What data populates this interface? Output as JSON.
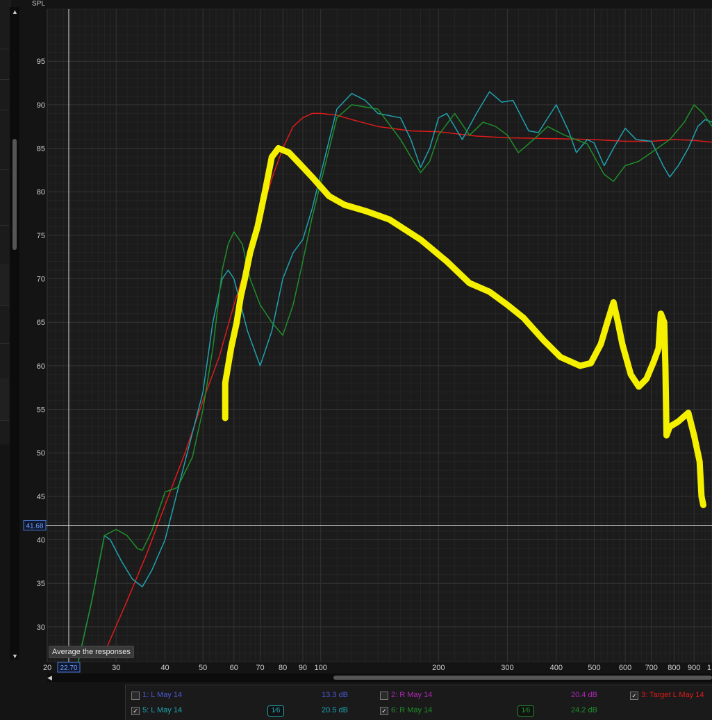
{
  "chart_data": {
    "type": "line",
    "ylabel": "SPL",
    "x_scale": "log",
    "xlim": [
      20,
      1000
    ],
    "ylim": [
      26,
      101
    ],
    "grid": true,
    "y_ticks": [
      30,
      35,
      40,
      45,
      50,
      55,
      60,
      65,
      70,
      75,
      80,
      85,
      90,
      95
    ],
    "x_ticks": [
      {
        "v": 20,
        "label": "20"
      },
      {
        "v": 30,
        "label": "30"
      },
      {
        "v": 40,
        "label": "40"
      },
      {
        "v": 50,
        "label": "50"
      },
      {
        "v": 60,
        "label": "60"
      },
      {
        "v": 70,
        "label": "70"
      },
      {
        "v": 80,
        "label": "80"
      },
      {
        "v": 90,
        "label": "90"
      },
      {
        "v": 100,
        "label": "100"
      },
      {
        "v": 200,
        "label": "200"
      },
      {
        "v": 300,
        "label": "300"
      },
      {
        "v": 400,
        "label": "400"
      },
      {
        "v": 500,
        "label": "500"
      },
      {
        "v": 600,
        "label": "600"
      },
      {
        "v": 700,
        "label": "700"
      },
      {
        "v": 800,
        "label": "800"
      },
      {
        "v": 900,
        "label": "900"
      },
      {
        "v": 1000,
        "label": "1"
      }
    ],
    "cursor": {
      "x": 22.7,
      "y": 41.68,
      "x_label": "22.70",
      "y_label": "41.68"
    },
    "series": [
      {
        "name": "3: Target L May 14",
        "color": "#e01b1b",
        "points": [
          [
            28,
            27
          ],
          [
            32,
            33
          ],
          [
            36,
            38.5
          ],
          [
            40,
            44
          ],
          [
            45,
            50
          ],
          [
            50,
            56
          ],
          [
            55,
            61
          ],
          [
            60,
            67
          ],
          [
            65,
            72
          ],
          [
            70,
            77
          ],
          [
            75,
            81.5
          ],
          [
            80,
            85
          ],
          [
            85,
            87.5
          ],
          [
            90,
            88.5
          ],
          [
            95,
            89
          ],
          [
            100,
            89
          ],
          [
            110,
            88.8
          ],
          [
            120,
            88.3
          ],
          [
            140,
            87.5
          ],
          [
            170,
            87
          ],
          [
            200,
            86.9
          ],
          [
            250,
            86.4
          ],
          [
            300,
            86.2
          ],
          [
            400,
            86.1
          ],
          [
            500,
            86
          ],
          [
            600,
            85.8
          ],
          [
            700,
            85.8
          ],
          [
            800,
            86
          ],
          [
            900,
            85.9
          ],
          [
            1000,
            85.7
          ]
        ]
      },
      {
        "name": "5: L May 14",
        "color": "#1fa3b0",
        "points": [
          [
            24,
            26
          ],
          [
            26,
            33
          ],
          [
            28,
            40.5
          ],
          [
            29,
            40
          ],
          [
            31,
            37.5
          ],
          [
            33,
            35.5
          ],
          [
            35,
            34.6
          ],
          [
            37,
            36.5
          ],
          [
            40,
            40
          ],
          [
            45,
            49
          ],
          [
            50,
            57
          ],
          [
            53,
            65
          ],
          [
            56,
            70
          ],
          [
            58,
            71
          ],
          [
            60,
            70
          ],
          [
            65,
            64
          ],
          [
            70,
            60
          ],
          [
            75,
            64
          ],
          [
            80,
            70
          ],
          [
            85,
            73
          ],
          [
            90,
            74.5
          ],
          [
            95,
            78
          ],
          [
            100,
            82
          ],
          [
            110,
            89.5
          ],
          [
            120,
            91.3
          ],
          [
            130,
            90.5
          ],
          [
            140,
            89
          ],
          [
            160,
            88.5
          ],
          [
            170,
            86
          ],
          [
            180,
            82.8
          ],
          [
            190,
            85
          ],
          [
            200,
            88.5
          ],
          [
            210,
            89
          ],
          [
            230,
            86
          ],
          [
            250,
            89
          ],
          [
            270,
            91.5
          ],
          [
            290,
            90.3
          ],
          [
            310,
            90.5
          ],
          [
            340,
            87
          ],
          [
            360,
            86.8
          ],
          [
            400,
            90
          ],
          [
            430,
            87
          ],
          [
            450,
            84.5
          ],
          [
            480,
            86
          ],
          [
            500,
            85.6
          ],
          [
            530,
            83
          ],
          [
            560,
            85
          ],
          [
            600,
            87.3
          ],
          [
            640,
            86
          ],
          [
            700,
            85.8
          ],
          [
            750,
            83
          ],
          [
            780,
            81.7
          ],
          [
            820,
            83
          ],
          [
            870,
            85
          ],
          [
            920,
            87.5
          ],
          [
            960,
            88.3
          ],
          [
            1000,
            88
          ]
        ]
      },
      {
        "name": "6: R May 14",
        "color": "#1f8f2a",
        "points": [
          [
            24,
            26
          ],
          [
            26,
            33
          ],
          [
            28,
            40.5
          ],
          [
            30,
            41.2
          ],
          [
            32,
            40.5
          ],
          [
            34,
            39
          ],
          [
            35,
            38.8
          ],
          [
            37,
            41
          ],
          [
            40,
            45.5
          ],
          [
            43,
            46
          ],
          [
            47,
            49.5
          ],
          [
            50,
            55
          ],
          [
            53,
            62
          ],
          [
            56,
            71
          ],
          [
            58,
            74
          ],
          [
            60,
            75.4
          ],
          [
            63,
            74
          ],
          [
            66,
            70
          ],
          [
            70,
            67
          ],
          [
            75,
            65
          ],
          [
            80,
            63.5
          ],
          [
            85,
            67
          ],
          [
            90,
            72
          ],
          [
            95,
            77
          ],
          [
            100,
            81
          ],
          [
            110,
            88.5
          ],
          [
            120,
            90
          ],
          [
            140,
            89.5
          ],
          [
            160,
            86
          ],
          [
            170,
            84
          ],
          [
            180,
            82.2
          ],
          [
            190,
            83.5
          ],
          [
            200,
            86.5
          ],
          [
            220,
            89
          ],
          [
            240,
            86.5
          ],
          [
            260,
            88
          ],
          [
            280,
            87.5
          ],
          [
            300,
            86.5
          ],
          [
            320,
            84.5
          ],
          [
            350,
            86
          ],
          [
            380,
            87.5
          ],
          [
            420,
            86.5
          ],
          [
            480,
            85.5
          ],
          [
            530,
            82
          ],
          [
            560,
            81.2
          ],
          [
            600,
            83
          ],
          [
            650,
            83.5
          ],
          [
            700,
            84.5
          ],
          [
            780,
            86
          ],
          [
            850,
            88
          ],
          [
            900,
            90
          ],
          [
            950,
            89
          ],
          [
            1000,
            87.5
          ]
        ]
      }
    ],
    "annotation": {
      "color": "#f5f000",
      "points": [
        [
          57,
          54
        ],
        [
          57,
          58
        ],
        [
          59,
          62
        ],
        [
          61,
          65
        ],
        [
          62.5,
          68
        ],
        [
          64,
          70
        ],
        [
          66,
          73
        ],
        [
          69,
          76
        ],
        [
          72,
          80
        ],
        [
          75,
          84
        ],
        [
          78,
          85
        ],
        [
          83,
          84.5
        ],
        [
          88,
          83.3
        ],
        [
          95,
          81.7
        ],
        [
          105,
          79.5
        ],
        [
          115,
          78.5
        ],
        [
          130,
          77.8
        ],
        [
          150,
          76.8
        ],
        [
          180,
          74.5
        ],
        [
          210,
          72
        ],
        [
          240,
          69.5
        ],
        [
          270,
          68.5
        ],
        [
          300,
          67
        ],
        [
          330,
          65.5
        ],
        [
          370,
          63
        ],
        [
          410,
          61
        ],
        [
          460,
          60
        ],
        [
          490,
          60.3
        ],
        [
          520,
          62.5
        ],
        [
          540,
          65
        ],
        [
          560,
          67.3
        ],
        [
          575,
          65
        ],
        [
          590,
          62.5
        ],
        [
          620,
          59
        ],
        [
          650,
          57.6
        ],
        [
          680,
          58.5
        ],
        [
          710,
          60.5
        ],
        [
          730,
          62
        ],
        [
          740,
          66
        ],
        [
          755,
          65
        ],
        [
          760,
          60
        ],
        [
          765,
          52
        ],
        [
          780,
          53
        ],
        [
          820,
          53.6
        ],
        [
          870,
          54.6
        ],
        [
          900,
          52
        ],
        [
          930,
          49
        ],
        [
          940,
          45
        ],
        [
          950,
          44
        ]
      ]
    }
  },
  "labels": {
    "spl": "SPL",
    "tooltip": "Average the responses"
  },
  "legend": {
    "items": [
      {
        "label": "1: L May 14",
        "checked": false,
        "color": "#4a58d4",
        "value": "13.3 dB",
        "value_color": "#4a58d4"
      },
      {
        "label": "2: R May 14",
        "checked": false,
        "color": "#b027b8",
        "value": "20.4 dB",
        "value_color": "#b027b8"
      },
      {
        "label": "3: Target L May 14",
        "checked": true,
        "color": "#e01b1b"
      },
      {
        "label": "5: L May 14",
        "checked": true,
        "color": "#1fa3b0",
        "value": "20.5 dB",
        "value_color": "#1fa3b0",
        "smoothing": "1⁄6"
      },
      {
        "label": "6: R May 14",
        "checked": true,
        "color": "#1f8f2a",
        "value": "24.2 dB",
        "value_color": "#1f8f2a",
        "smoothing": "1⁄6"
      }
    ]
  },
  "check_glyph": "✓"
}
